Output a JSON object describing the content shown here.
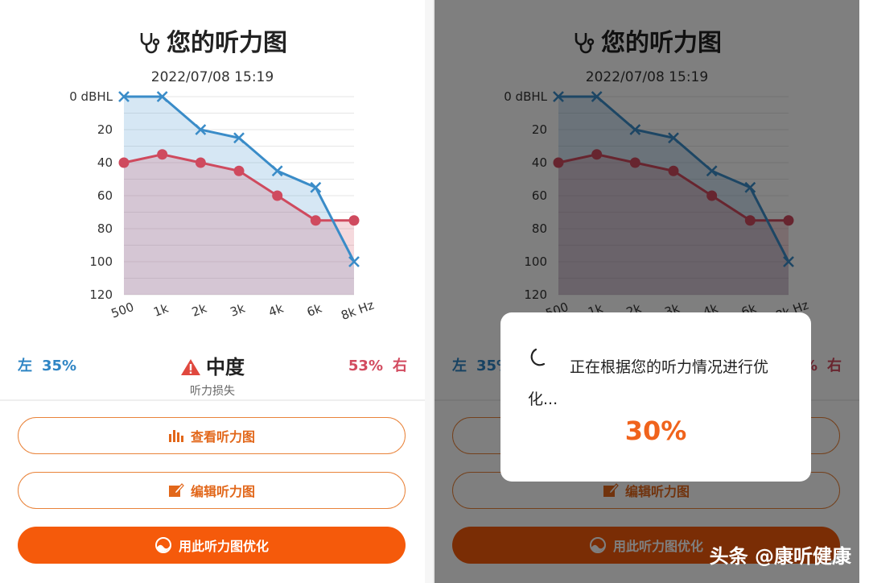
{
  "screen": {
    "title": "您的听力图",
    "date": "2022/07/08 15:19"
  },
  "chart_data": {
    "type": "line",
    "x": [
      "500",
      "1k",
      "2k",
      "3k",
      "4k",
      "6k",
      "8k Hz"
    ],
    "y_ticks": [
      "0 dBHL",
      "20",
      "40",
      "60",
      "80",
      "100",
      "120"
    ],
    "ylim": [
      0,
      120
    ],
    "y_inverted": true,
    "grid": true,
    "series": [
      {
        "marker": "x",
        "color": "#3a8cc8",
        "values": [
          0,
          0,
          20,
          25,
          45,
          55,
          100
        ]
      },
      {
        "marker": "circle",
        "color": "#cf4a5e",
        "values": [
          40,
          35,
          40,
          45,
          60,
          75,
          75
        ]
      }
    ]
  },
  "summary": {
    "left_label": "左",
    "left_value": "35%",
    "right_label": "右",
    "right_value": "53%",
    "level": "中度",
    "level_sub": "听力损失"
  },
  "buttons": {
    "view": "查看听力图",
    "edit": "编辑听力图",
    "optimize": "用此听力图优化"
  },
  "dialog": {
    "message": "正在根据您的听力情况进行优化...",
    "progress": "30%"
  },
  "watermark": "头条 @康听健康",
  "colors": {
    "accent": "#f55a0b",
    "left": "#2f85c4",
    "right": "#d24b5f"
  }
}
